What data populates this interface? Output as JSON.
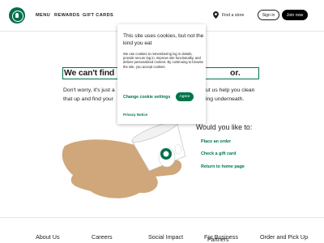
{
  "header": {
    "nav": [
      "MENU",
      "REWARDS",
      "GIFT CARDS"
    ],
    "find_store": "Find a store",
    "sign_in": "Sign in",
    "join_now": "Join now"
  },
  "main": {
    "headline_start": "We can't find",
    "headline_end": "or.",
    "body_left_1": "Don't worry, it's just a",
    "body_left_2": "that up and find your",
    "body_right_1": "ut us help you clean",
    "body_right_2": "ing underneath.",
    "would_like": "Would you like to:",
    "links": [
      "Place an order",
      "Check a gift card",
      "Return to home page"
    ]
  },
  "cookie": {
    "title": "This site uses cookies, but not the kind you eat",
    "body": "We use cookies to remembering log in details, provide secure log in, improve site functionality, and deliver personalized content. By continuing to browse the site, you accept cookies.",
    "settings": "Change cookie settings",
    "agree": "Agree",
    "privacy": "Privacy Notice"
  },
  "footer": {
    "columns": [
      "About Us",
      "Careers",
      "Social Impact",
      "For Business",
      "Order and Pick Up"
    ],
    "business_sub": "Partners"
  },
  "colors": {
    "brand_green": "#00704a",
    "accent_green": "#00754a",
    "paper": "#cfa77a"
  }
}
